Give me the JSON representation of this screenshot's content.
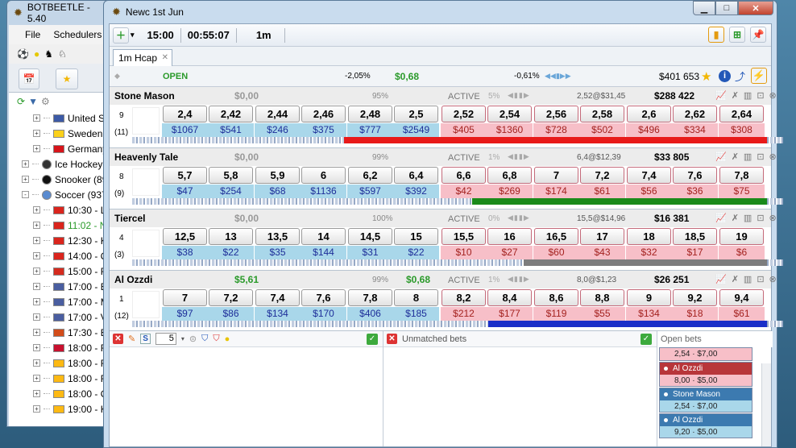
{
  "desktop": {
    "accent": "#3d6e8e"
  },
  "main_window": {
    "title": "BOTBEETLE - 5.40",
    "menu": [
      "File",
      "Schedulers"
    ],
    "tree": [
      {
        "level": 1,
        "expander": "+",
        "flag_color": "#3c5aa6",
        "label": "United State"
      },
      {
        "level": 1,
        "expander": "+",
        "flag_color": "#fbd11b",
        "label": "Sweden"
      },
      {
        "level": 1,
        "expander": "+",
        "flag_color": "#d7141a",
        "label": "Germany"
      },
      {
        "level": 0,
        "expander": "+",
        "flag_color": "#333333",
        "label": "Ice Hockey (3"
      },
      {
        "level": 0,
        "expander": "+",
        "flag_color": "#111111",
        "label": "Snooker (89)"
      },
      {
        "level": 0,
        "expander": "-",
        "flag_color": "#5a8bd0",
        "label": "Soccer (937)"
      },
      {
        "level": 1,
        "expander": "+",
        "flag_color": "#da251d",
        "label": "10:30 - Lar"
      },
      {
        "level": 1,
        "expander": "+",
        "flag_color": "#da251d",
        "label": "11:02 - Nat",
        "color": "#2a9a2a"
      },
      {
        "level": 1,
        "expander": "+",
        "flag_color": "#da251d",
        "label": "12:30 - Kha"
      },
      {
        "level": 1,
        "expander": "+",
        "flag_color": "#da251d",
        "label": "14:00 - Qu"
      },
      {
        "level": 1,
        "expander": "+",
        "flag_color": "#d52b1e",
        "label": "15:00 - Ran"
      },
      {
        "level": 1,
        "expander": "+",
        "flag_color": "#4a5ea0",
        "label": "17:00 - B36"
      },
      {
        "level": 1,
        "expander": "+",
        "flag_color": "#4a5ea0",
        "label": "17:00 - Mic"
      },
      {
        "level": 1,
        "expander": "+",
        "flag_color": "#4a5ea0",
        "label": "17:00 - Vik"
      },
      {
        "level": 1,
        "expander": "+",
        "flag_color": "#d24c1a",
        "label": "17:30 - Bar"
      },
      {
        "level": 1,
        "expander": "+",
        "flag_color": "#c8102e",
        "label": "18:00 - FC"
      },
      {
        "level": 1,
        "expander": "+",
        "flag_color": "#fdb913",
        "label": "18:00 - FK"
      },
      {
        "level": 1,
        "expander": "+",
        "flag_color": "#fdb913",
        "label": "18:00 - FK"
      },
      {
        "level": 1,
        "expander": "+",
        "flag_color": "#fdb913",
        "label": "18:00 - OF"
      },
      {
        "level": 1,
        "expander": "+",
        "flag_color": "#fdb913",
        "label": "19:00 - Kol"
      }
    ]
  },
  "race_window": {
    "title": "Newc 1st Jun",
    "toolbar": {
      "time": "15:00",
      "countdown": "00:55:07",
      "interval": "1m"
    },
    "tab": {
      "label": "1m Hcap"
    },
    "status": {
      "state": "OPEN",
      "back_pct": "-2,05%",
      "matched": "$0,68",
      "lay_pct": "-0,61%",
      "total": "$401 653"
    },
    "runners": [
      {
        "name": "Stone Mason",
        "pl": "$0,00",
        "pl_class": "",
        "pct": "95%",
        "pl2": "",
        "state": "ACTIVE",
        "pct2": "5%",
        "bet": "2,52@$31,45",
        "money": "$288 422",
        "number": "9",
        "count": "(11)",
        "back_odds": [
          "2,4",
          "2,42",
          "2,44",
          "2,46",
          "2,48",
          "2,5"
        ],
        "back_amts": [
          "$1067",
          "$541",
          "$246",
          "$375",
          "$777",
          "$2549"
        ],
        "lay_odds": [
          "2,52",
          "2,54",
          "2,56",
          "2,58",
          "2,6",
          "2,62",
          "2,64"
        ],
        "lay_amts": [
          "$405",
          "$1360",
          "$728",
          "$502",
          "$496",
          "$334",
          "$308"
        ],
        "bar_color": "#e81a1a"
      },
      {
        "name": "Heavenly Tale",
        "pl": "$0,00",
        "pl_class": "",
        "pct": "99%",
        "pl2": "",
        "state": "ACTIVE",
        "pct2": "1%",
        "bet": "6,4@$12,39",
        "money": "$33 805",
        "number": "8",
        "count": "(9)",
        "back_odds": [
          "5,7",
          "5,8",
          "5,9",
          "6",
          "6,2",
          "6,4"
        ],
        "back_amts": [
          "$47",
          "$254",
          "$68",
          "$1136",
          "$597",
          "$392"
        ],
        "lay_odds": [
          "6,6",
          "6,8",
          "7",
          "7,2",
          "7,4",
          "7,6",
          "7,8"
        ],
        "lay_amts": [
          "$42",
          "$269",
          "$174",
          "$61",
          "$56",
          "$36",
          "$75"
        ],
        "bar_color": "#1a8a1a"
      },
      {
        "name": "Tiercel",
        "pl": "$0,00",
        "pl_class": "",
        "pct": "100%",
        "pl2": "",
        "state": "ACTIVE",
        "pct2": "0%",
        "bet": "15,5@$14,96",
        "money": "$16 381",
        "number": "4",
        "count": "(3)",
        "back_odds": [
          "12,5",
          "13",
          "13,5",
          "14",
          "14,5",
          "15"
        ],
        "back_amts": [
          "$38",
          "$22",
          "$35",
          "$144",
          "$31",
          "$22"
        ],
        "lay_odds": [
          "15,5",
          "16",
          "16,5",
          "17",
          "18",
          "18,5",
          "19"
        ],
        "lay_amts": [
          "$10",
          "$27",
          "$60",
          "$43",
          "$32",
          "$17",
          "$6"
        ],
        "bar_color": "#7d7d7d"
      },
      {
        "name": "Al Ozzdi",
        "pl": "$5,61",
        "pl_class": "pos",
        "pct": "99%",
        "pl2": "$0,68",
        "state": "ACTIVE",
        "pct2": "1%",
        "bet": "8,0@$1,23",
        "money": "$26 251",
        "number": "1",
        "count": "(12)",
        "back_odds": [
          "7",
          "7,2",
          "7,4",
          "7,6",
          "7,8",
          "8"
        ],
        "back_amts": [
          "$97",
          "$86",
          "$134",
          "$170",
          "$406",
          "$185"
        ],
        "lay_odds": [
          "8,2",
          "8,4",
          "8,6",
          "8,8",
          "9",
          "9,2",
          "9,4"
        ],
        "lay_amts": [
          "$212",
          "$177",
          "$119",
          "$55",
          "$134",
          "$18",
          "$61"
        ],
        "bar_color": "#1a2fc8"
      }
    ],
    "bottom": {
      "stake_value": "5",
      "unmatched_title": "Unmatched bets",
      "open_title": "Open bets",
      "open_bets": [
        {
          "name": "",
          "odds_stake": "2,54 · $7,00",
          "kind": "lay"
        },
        {
          "name": "Al Ozzdi",
          "odds_stake": "8,00 · $5,00",
          "kind": "lay"
        },
        {
          "name": "Stone Mason",
          "odds_stake": "2,54 · $7,00",
          "kind": "back"
        },
        {
          "name": "Al Ozzdi",
          "odds_stake": "9,20 · $5,00",
          "kind": "back"
        }
      ]
    }
  }
}
